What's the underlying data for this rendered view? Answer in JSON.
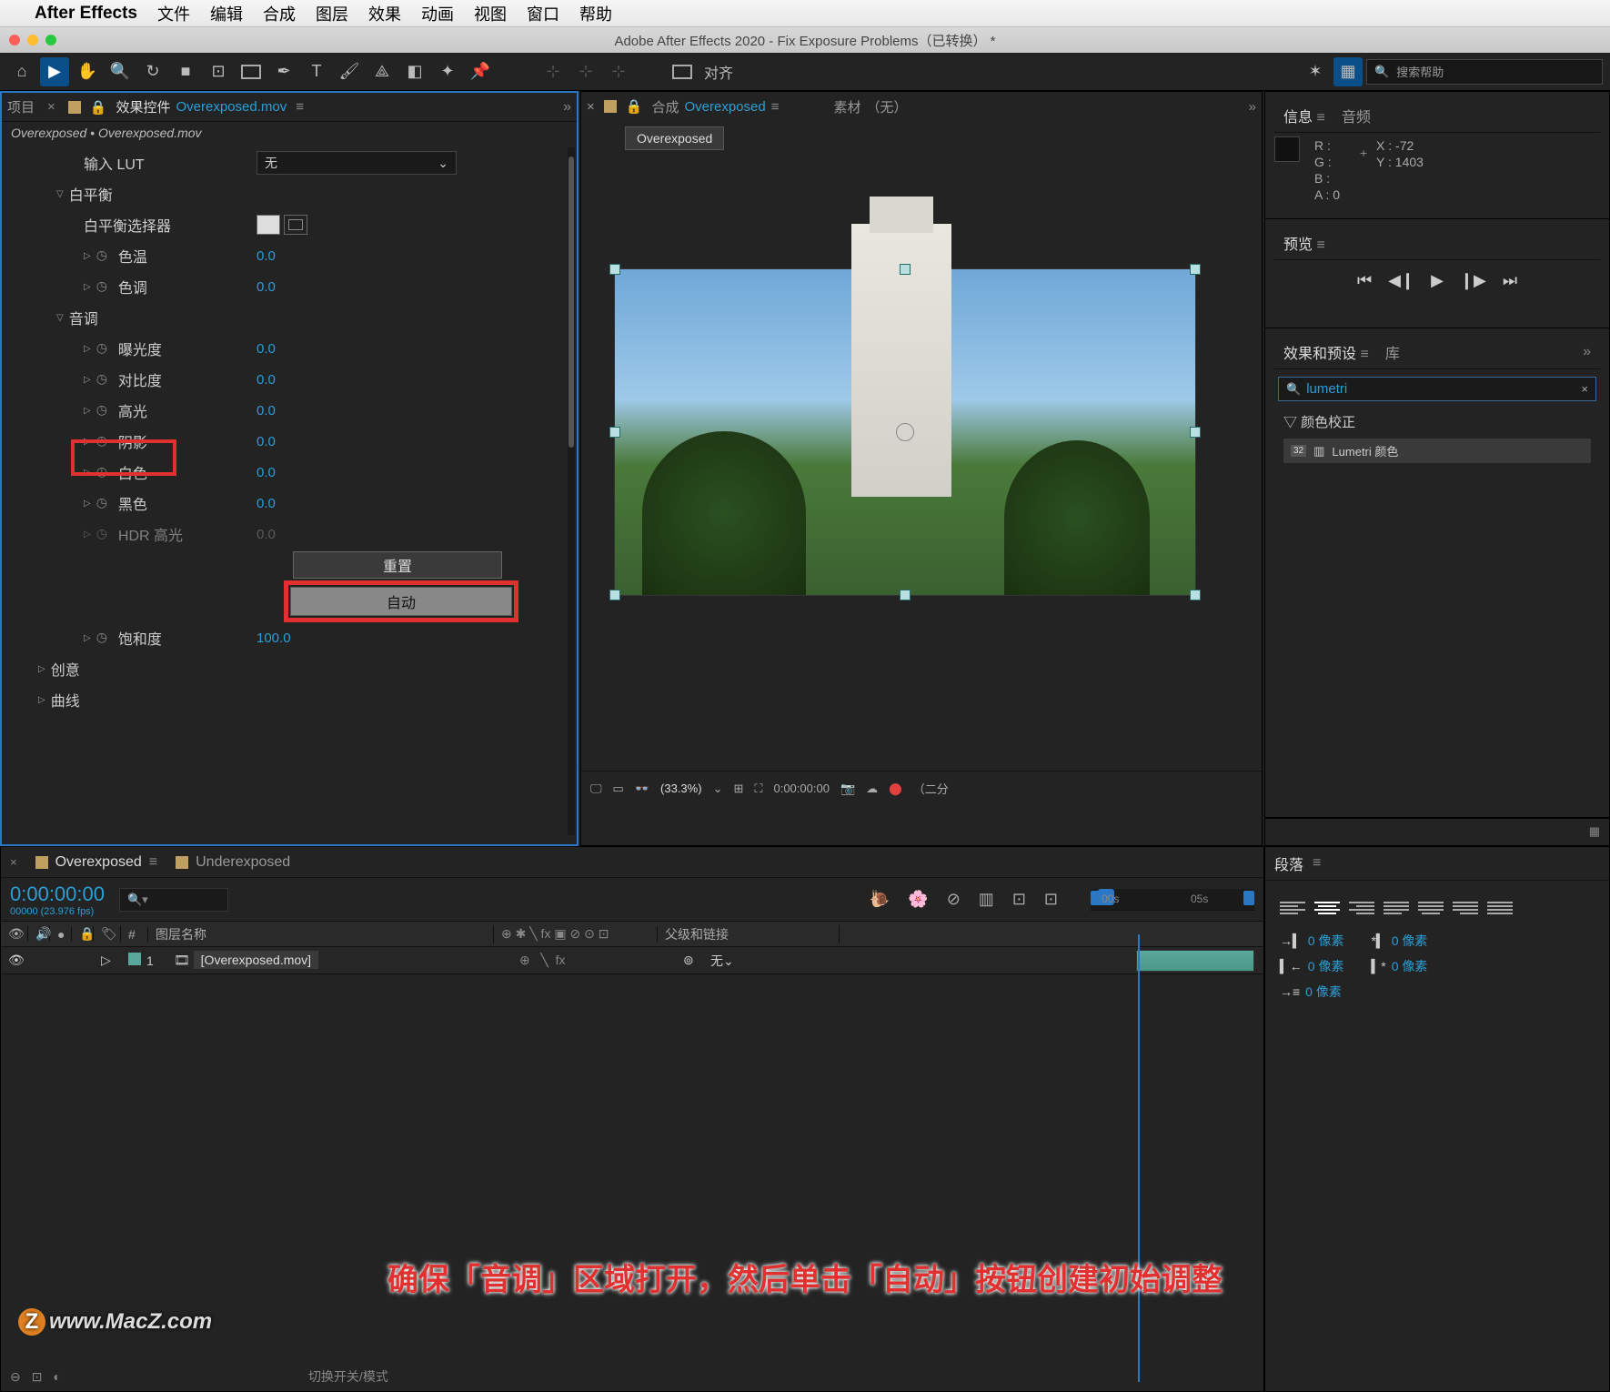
{
  "menubar": {
    "app": "After Effects",
    "items": [
      "文件",
      "编辑",
      "合成",
      "图层",
      "效果",
      "动画",
      "视图",
      "窗口",
      "帮助"
    ]
  },
  "window_title": "Adobe After Effects 2020 - Fix Exposure Problems（已转换） *",
  "toolbar": {
    "align_label": "对齐",
    "search_placeholder": "搜索帮助"
  },
  "left_panel": {
    "tab_project": "项目",
    "tab_effect_controls": "效果控件",
    "effect_target": "Overexposed.mov",
    "breadcrumb": "Overexposed • Overexposed.mov",
    "rows": {
      "input_lut": "输入 LUT",
      "input_lut_value": "无",
      "white_balance": "白平衡",
      "wb_selector": "白平衡选择器",
      "temperature": "色温",
      "temperature_val": "0.0",
      "tint": "色调",
      "tint_val": "0.0",
      "tone": "音调",
      "exposure": "曝光度",
      "exposure_val": "0.0",
      "contrast": "对比度",
      "contrast_val": "0.0",
      "highlights": "高光",
      "highlights_val": "0.0",
      "shadows": "阴影",
      "shadows_val": "0.0",
      "whites": "白色",
      "whites_val": "0.0",
      "blacks": "黑色",
      "blacks_val": "0.0",
      "hdr": "HDR 高光",
      "hdr_val": "0.0",
      "reset_btn": "重置",
      "auto_btn": "自动",
      "saturation": "饱和度",
      "saturation_val": "100.0",
      "creative": "创意",
      "curves": "曲线"
    }
  },
  "center_panel": {
    "tab_composition": "合成",
    "comp_name": "Overexposed",
    "tab_footage": "素材",
    "footage_value": "（无）",
    "chip": "Overexposed",
    "footer": {
      "zoom": "(33.3%)",
      "time": "0:00:00:00",
      "res": "（二分"
    }
  },
  "right_panel": {
    "info_tab": "信息",
    "audio_tab": "音频",
    "info": {
      "r": "R :",
      "g": "G :",
      "b": "B :",
      "a": "A :  0",
      "x": "X :  -72",
      "y": "Y :  1403"
    },
    "preview_tab": "预览",
    "effects_presets_tab": "效果和预设",
    "library_tab": "库",
    "search_value": "lumetri",
    "tree_group": "颜色校正",
    "tree_item": "Lumetri 颜色"
  },
  "timeline": {
    "tab_active": "Overexposed",
    "tab_inactive": "Underexposed",
    "timecode": "0:00:00:00",
    "fps": "00000 (23.976 fps)",
    "cols": {
      "num": "#",
      "layer_name": "图层名称",
      "parent": "父级和链接"
    },
    "row1": {
      "num": "1",
      "name": "[Overexposed.mov]",
      "parent": "无"
    },
    "ruler": {
      "t0": "00s",
      "t1": "05s"
    },
    "footer_label": "切换开关/模式"
  },
  "paragraph": {
    "tab": "段落",
    "px": "0 像素"
  },
  "caption": "确保「音调」区域打开，然后单击「自动」按钮创建初始调整",
  "watermark": "www.MacZ.com"
}
